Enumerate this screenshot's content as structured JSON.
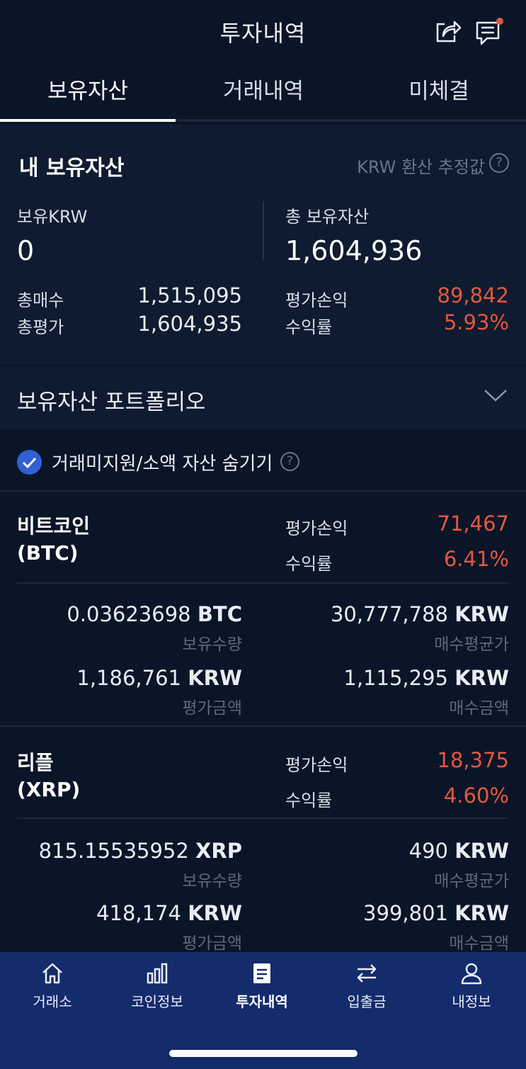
{
  "header": {
    "title": "투자내역"
  },
  "tabs": [
    {
      "label": "보유자산",
      "active": true
    },
    {
      "label": "거래내역",
      "active": false
    },
    {
      "label": "미체결",
      "active": false
    }
  ],
  "summary": {
    "heading": "내 보유자산",
    "note": "KRW 환산 추정값",
    "krw_label": "보유KRW",
    "krw_value": "0",
    "total_label": "총 보유자산",
    "total_value": "1,604,936",
    "buy_total_label": "총매수",
    "buy_total_value": "1,515,095",
    "eval_total_label": "총평가",
    "eval_total_value": "1,604,935",
    "pnl_label": "평가손익",
    "pnl_value": "89,842",
    "return_label": "수익률",
    "return_value": "5.93%"
  },
  "portfolio": {
    "label": "보유자산 포트폴리오"
  },
  "hide_option": {
    "label": "거래미지원/소액 자산 숨기기",
    "checked": true
  },
  "assets": [
    {
      "name_line1": "비트코인",
      "name_line2": "(BTC)",
      "pnl_label": "평가손익",
      "pnl_value": "71,467",
      "return_label": "수익률",
      "return_value": "6.41%",
      "qty_number": "0.03623698",
      "qty_unit": "BTC",
      "qty_label": "보유수량",
      "avg_number": "30,777,788",
      "avg_unit": "KRW",
      "avg_label": "매수평균가",
      "eval_number": "1,186,761",
      "eval_unit": "KRW",
      "eval_label": "평가금액",
      "buy_number": "1,115,295",
      "buy_unit": "KRW",
      "buy_label": "매수금액"
    },
    {
      "name_line1": "리플",
      "name_line2": "(XRP)",
      "pnl_label": "평가손익",
      "pnl_value": "18,375",
      "return_label": "수익률",
      "return_value": "4.60%",
      "qty_number": "815.15535952",
      "qty_unit": "XRP",
      "qty_label": "보유수량",
      "avg_number": "490",
      "avg_unit": "KRW",
      "avg_label": "매수평균가",
      "eval_number": "418,174",
      "eval_unit": "KRW",
      "eval_label": "평가금액",
      "buy_number": "399,801",
      "buy_unit": "KRW",
      "buy_label": "매수금액"
    }
  ],
  "bottom_nav": [
    {
      "label": "거래소",
      "icon": "home-icon",
      "active": false
    },
    {
      "label": "코인정보",
      "icon": "bar-chart-icon",
      "active": false
    },
    {
      "label": "투자내역",
      "icon": "document-icon",
      "active": true
    },
    {
      "label": "입출금",
      "icon": "transfer-icon",
      "active": false
    },
    {
      "label": "내정보",
      "icon": "person-icon",
      "active": false
    }
  ],
  "colors": {
    "positive": "#e2593f",
    "accent": "#3160d3",
    "nav_bg": "#142b6c",
    "bg": "#0b1528"
  }
}
